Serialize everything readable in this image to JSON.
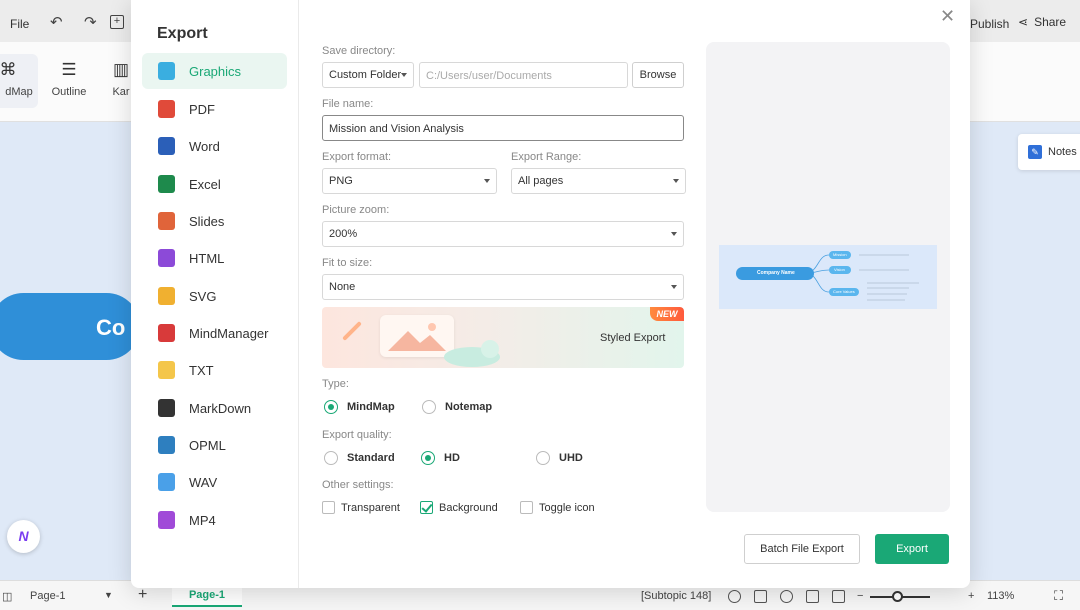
{
  "app": {
    "file_menu": "File",
    "publish": "Publish",
    "share": "Share",
    "views": [
      {
        "label": "dMap"
      },
      {
        "label": "Outline"
      },
      {
        "label": "Kar"
      }
    ],
    "central_node_text": "Co",
    "notes": "Notes",
    "status": {
      "page_select": "Page-1",
      "page_tab": "Page-1",
      "subtopic": "[Subtopic 148]",
      "zoom": "113%"
    }
  },
  "export_dialog": {
    "title": "Export",
    "formats": [
      {
        "label": "Graphics",
        "color": "#3aaee0"
      },
      {
        "label": "PDF",
        "color": "#e04a3a"
      },
      {
        "label": "Word",
        "color": "#2b5fb8"
      },
      {
        "label": "Excel",
        "color": "#1e8a4c"
      },
      {
        "label": "Slides",
        "color": "#e0643a"
      },
      {
        "label": "HTML",
        "color": "#8c4ad8"
      },
      {
        "label": "SVG",
        "color": "#f0b030"
      },
      {
        "label": "MindManager",
        "color": "#d83a3a"
      },
      {
        "label": "TXT",
        "color": "#f4c64a"
      },
      {
        "label": "MarkDown",
        "color": "#333333"
      },
      {
        "label": "OPML",
        "color": "#2e7fbf"
      },
      {
        "label": "WAV",
        "color": "#4aa0e8"
      },
      {
        "label": "MP4",
        "color": "#a04ad8"
      }
    ],
    "active_format": "Graphics",
    "save_directory": {
      "label": "Save directory:",
      "mode": "Custom Folder",
      "path_placeholder": "C:/Users/user/Documents",
      "browse": "Browse"
    },
    "file_name": {
      "label": "File name:",
      "value": "Mission and Vision Analysis"
    },
    "export_format": {
      "label": "Export format:",
      "value": "PNG"
    },
    "export_range": {
      "label": "Export Range:",
      "value": "All pages"
    },
    "picture_zoom": {
      "label": "Picture zoom:",
      "value": "200%"
    },
    "fit_to_size": {
      "label": "Fit to size:",
      "value": "None"
    },
    "styled_export": {
      "label": "Styled Export",
      "badge": "NEW"
    },
    "type": {
      "label": "Type:",
      "options": [
        "MindMap",
        "Notemap"
      ],
      "selected": "MindMap"
    },
    "quality": {
      "label": "Export quality:",
      "options": [
        "Standard",
        "HD",
        "UHD"
      ],
      "selected": "HD"
    },
    "other_settings": {
      "label": "Other settings:",
      "options": [
        {
          "label": "Transparent",
          "checked": false
        },
        {
          "label": "Background",
          "checked": true
        },
        {
          "label": "Toggle icon",
          "checked": false
        }
      ]
    },
    "preview": {
      "central": "Company Name",
      "branches": [
        "Mission",
        "Vision",
        "Core Values"
      ]
    },
    "batch_button": "Batch File Export",
    "export_button": "Export",
    "accent": "#1aa876"
  }
}
